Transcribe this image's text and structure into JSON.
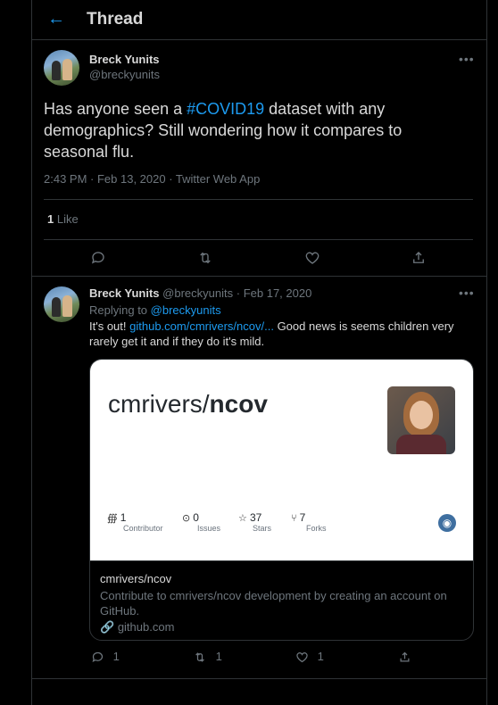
{
  "header": {
    "back_icon": "back-arrow-icon",
    "title": "Thread"
  },
  "main_tweet": {
    "author_name": "Breck Yunits",
    "author_handle": "@breckyunits",
    "text_before": "Has anyone seen a ",
    "hashtag": "#COVID19",
    "text_after": " dataset with any demographics? Still wondering how it compares to seasonal flu.",
    "meta": "2:43 PM · Feb 13, 2020 · Twitter Web App",
    "like_count": "1",
    "like_label": " Like",
    "more": "•••"
  },
  "reply_tweet": {
    "author_name": "Breck Yunits",
    "author_handle": "@breckyunits",
    "dot": "·",
    "date": "Feb 17, 2020",
    "replying_prefix": "Replying to ",
    "replying_handle": "@breckyunits",
    "text_before": "It's out! ",
    "link": "github.com/cmrivers/ncov/...",
    "text_after": " Good news is seems children very rarely get it and if they do it's mild.",
    "more": "•••",
    "reply_count": "1",
    "retweet_count": "1",
    "like_count": "1"
  },
  "card": {
    "title_user": "cmrivers/",
    "title_repo": "ncov",
    "stats": [
      {
        "icon": "👥",
        "value": "1",
        "label": "Contributor"
      },
      {
        "icon": "⊙",
        "value": "0",
        "label": "Issues"
      },
      {
        "icon": "☆",
        "value": "37",
        "label": "Stars"
      },
      {
        "icon": "⑂",
        "value": "7",
        "label": "Forks"
      }
    ],
    "site_title": "cmrivers/ncov",
    "description": "Contribute to cmrivers/ncov development by creating an account on GitHub.",
    "domain": "github.com"
  }
}
